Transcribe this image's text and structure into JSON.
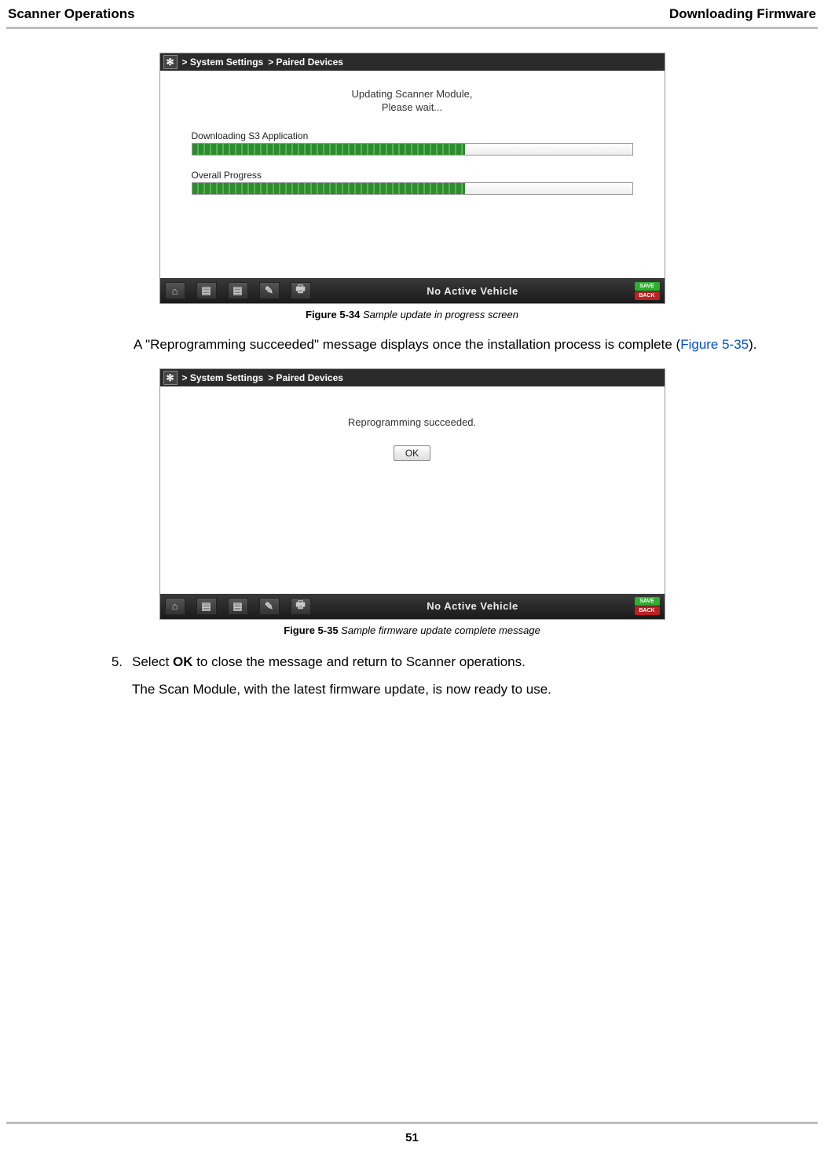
{
  "header": {
    "left": "Scanner Operations",
    "right": "Downloading Firmware"
  },
  "screenshot1": {
    "breadcrumb1": "> System Settings",
    "breadcrumb2": "> Paired Devices",
    "status_line1": "Updating Scanner Module,",
    "status_line2": "Please wait...",
    "progress1_label": "Downloading S3 Application",
    "progress2_label": "Overall Progress",
    "vehicle_status": "No Active Vehicle",
    "pill1": "SAVE",
    "pill2": "BACK",
    "home_icon": "⌂",
    "icon2": "▤",
    "icon3": "▤",
    "icon4": "✎",
    "icon5": "🖶",
    "gear": "✻"
  },
  "caption1": {
    "bold": "Figure 5-34 ",
    "italic": "Sample update in progress screen"
  },
  "para1_a": "A \"Reprogramming succeeded\" message displays once the installation process is complete (",
  "para1_link": "Figure 5-35",
  "para1_b": ").",
  "screenshot2": {
    "breadcrumb1": "> System Settings",
    "breadcrumb2": "> Paired Devices",
    "status_line1": "Reprogramming succeeded.",
    "ok_label": "OK",
    "vehicle_status": "No Active Vehicle",
    "pill1": "SAVE",
    "pill2": "BACK",
    "home_icon": "⌂",
    "icon2": "▤",
    "icon3": "▤",
    "icon4": "✎",
    "icon5": "🖶",
    "gear": "✻"
  },
  "caption2": {
    "bold": "Figure 5-35 ",
    "italic": "Sample firmware update complete message"
  },
  "step5_num": "5.",
  "step5_text_a": "Select ",
  "step5_text_bold": "OK",
  "step5_text_b": " to close the message and return to Scanner operations.",
  "step5_sub": "The Scan Module, with the latest firmware update, is now ready to use.",
  "page_number": "51"
}
